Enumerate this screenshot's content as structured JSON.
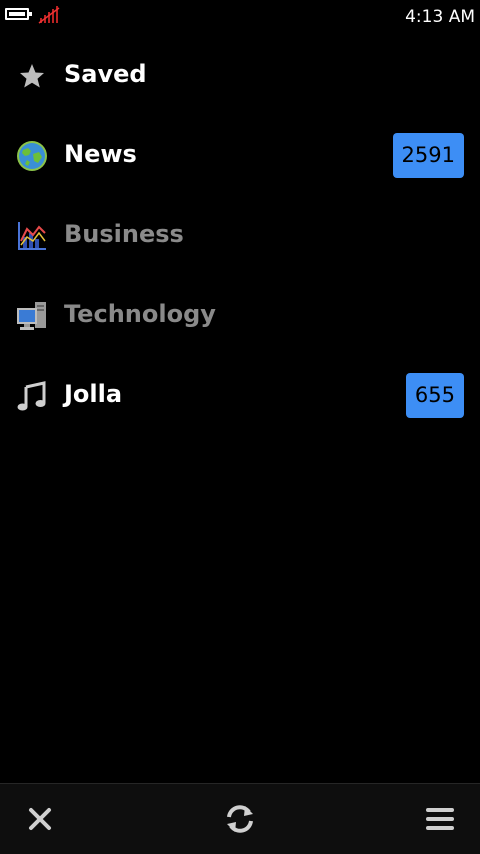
{
  "status_bar": {
    "time": "4:13 AM",
    "battery_icon": "battery-icon",
    "signal_icon": "no-signal-icon"
  },
  "feeds": [
    {
      "label": "Saved",
      "icon": "star-icon",
      "dimmed": false,
      "count": null
    },
    {
      "label": "News",
      "icon": "globe-icon",
      "dimmed": false,
      "count": "2591"
    },
    {
      "label": "Business",
      "icon": "chart-icon",
      "dimmed": true,
      "count": null
    },
    {
      "label": "Technology",
      "icon": "computer-icon",
      "dimmed": true,
      "count": null
    },
    {
      "label": "Jolla",
      "icon": "music-note-icon",
      "dimmed": false,
      "count": "655"
    }
  ],
  "toolbar": {
    "close_icon": "close-icon",
    "refresh_icon": "refresh-icon",
    "menu_icon": "menu-icon"
  },
  "colors": {
    "background": "#000000",
    "badge": "#3d8ef5",
    "dim_text": "#8a8a8a",
    "toolbar": "#0e0e0e"
  }
}
